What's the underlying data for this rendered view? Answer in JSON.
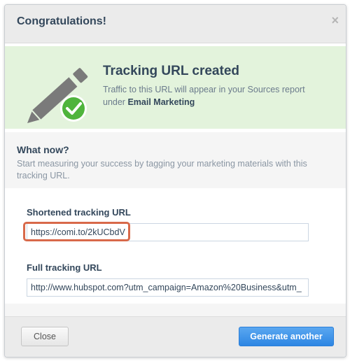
{
  "dialog": {
    "title": "Congratulations!",
    "close_symbol": "×"
  },
  "banner": {
    "heading": "Tracking URL created",
    "text_prefix": "Traffic to this URL will appear in your Sources report under ",
    "text_bold": "Email Marketing",
    "icon": "pencil-check-icon",
    "colors": {
      "background": "#e3f3dc",
      "pencil": "#7a7a7a",
      "check_circle": "#4fb43c"
    }
  },
  "what_now": {
    "heading": "What now?",
    "text": "Start measuring your success by tagging your marketing materials with this tracking URL."
  },
  "fields": {
    "short": {
      "label": "Shortened tracking URL",
      "value": "https://comi.to/2kUCbdV"
    },
    "full": {
      "label": "Full tracking URL",
      "value": "http://www.hubspot.com?utm_campaign=Amazon%20Business&utm_"
    }
  },
  "footer": {
    "close_label": "Close",
    "generate_label": "Generate another"
  },
  "colors": {
    "primary_button": "#2d86e3",
    "highlight": "#d8694a",
    "text_dark": "#33475b"
  }
}
